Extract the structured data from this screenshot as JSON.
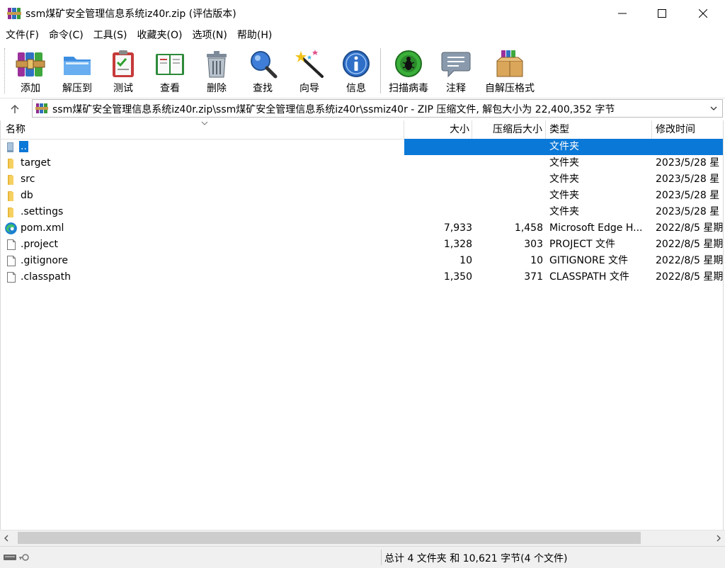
{
  "window": {
    "title": "ssm煤矿安全管理信息系统iz40r.zip (评估版本)",
    "icon": "winrar-archive-icon"
  },
  "menu": [
    "文件(F)",
    "命令(C)",
    "工具(S)",
    "收藏夹(O)",
    "选项(N)",
    "帮助(H)"
  ],
  "toolbar": [
    {
      "label": "添加",
      "icon": "add-archive-icon"
    },
    {
      "label": "解压到",
      "icon": "extract-folder-icon"
    },
    {
      "label": "测试",
      "icon": "test-clipboard-icon"
    },
    {
      "label": "查看",
      "icon": "view-book-icon"
    },
    {
      "label": "删除",
      "icon": "delete-trash-icon"
    },
    {
      "label": "查找",
      "icon": "find-magnifier-icon"
    },
    {
      "label": "向导",
      "icon": "wizard-wand-icon"
    },
    {
      "label": "信息",
      "icon": "info-icon"
    },
    {
      "label": "扫描病毒",
      "icon": "virus-scan-icon"
    },
    {
      "label": "注释",
      "icon": "comment-icon"
    },
    {
      "label": "自解压格式",
      "icon": "sfx-box-icon"
    }
  ],
  "address": {
    "text": "ssm煤矿安全管理信息系统iz40r.zip\\ssm煤矿安全管理信息系统iz40r\\ssmiz40r - ZIP 压缩文件, 解包大小为 22,400,352 字节"
  },
  "columns": {
    "name": "名称",
    "size": "大小",
    "packed": "压缩后大小",
    "type": "类型",
    "modified": "修改时间"
  },
  "files": [
    {
      "name": "..",
      "size": "",
      "packed": "",
      "type": "文件夹",
      "modified": "",
      "icon": "parent-folder-icon",
      "selected": true
    },
    {
      "name": "target",
      "size": "",
      "packed": "",
      "type": "文件夹",
      "modified": "2023/5/28 星",
      "icon": "folder-icon"
    },
    {
      "name": "src",
      "size": "",
      "packed": "",
      "type": "文件夹",
      "modified": "2023/5/28 星",
      "icon": "folder-icon"
    },
    {
      "name": "db",
      "size": "",
      "packed": "",
      "type": "文件夹",
      "modified": "2023/5/28 星",
      "icon": "folder-icon"
    },
    {
      "name": ".settings",
      "size": "",
      "packed": "",
      "type": "文件夹",
      "modified": "2023/5/28 星",
      "icon": "folder-icon"
    },
    {
      "name": "pom.xml",
      "size": "7,933",
      "packed": "1,458",
      "type": "Microsoft Edge H...",
      "modified": "2022/8/5 星期",
      "icon": "edge-icon"
    },
    {
      "name": ".project",
      "size": "1,328",
      "packed": "303",
      "type": "PROJECT 文件",
      "modified": "2022/8/5 星期",
      "icon": "file-icon"
    },
    {
      "name": ".gitignore",
      "size": "10",
      "packed": "10",
      "type": "GITIGNORE 文件",
      "modified": "2022/8/5 星期",
      "icon": "file-icon"
    },
    {
      "name": ".classpath",
      "size": "1,350",
      "packed": "371",
      "type": "CLASSPATH 文件",
      "modified": "2022/8/5 星期",
      "icon": "file-icon"
    }
  ],
  "status": {
    "text": "总计 4 文件夹 和 10,621 字节(4 个文件)"
  },
  "colors": {
    "selection": "#0a78d7",
    "folder": "#f4c94a",
    "background": "#ffffff",
    "statusbar": "#f0f0f0"
  }
}
